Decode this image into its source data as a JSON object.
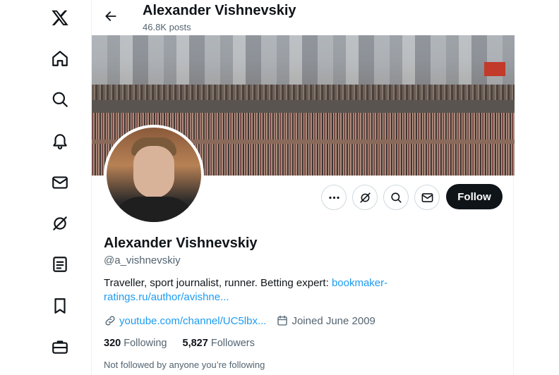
{
  "nav": {
    "items": [
      {
        "name": "x-logo",
        "icon": "x-logo-icon"
      },
      {
        "name": "home",
        "icon": "home-icon"
      },
      {
        "name": "explore",
        "icon": "search-icon"
      },
      {
        "name": "notifications",
        "icon": "bell-icon"
      },
      {
        "name": "messages",
        "icon": "envelope-icon"
      },
      {
        "name": "grok",
        "icon": "grok-icon"
      },
      {
        "name": "lists",
        "icon": "list-icon"
      },
      {
        "name": "bookmarks",
        "icon": "bookmark-icon"
      },
      {
        "name": "jobs",
        "icon": "briefcase-icon"
      }
    ]
  },
  "header": {
    "title": "Alexander Vishnevskiy",
    "post_count": "46.8K posts"
  },
  "profile": {
    "display_name": "Alexander Vishnevskiy",
    "handle": "@a_vishnevskiy",
    "bio_text": "Traveller, sport journalist, runner. Betting expert: ",
    "bio_link_line1": "bookmaker-",
    "bio_link_line2": "ratings.ru/author/avishne...",
    "website": "youtube.com/channel/UC5lbx...",
    "joined": "Joined June 2009",
    "following_count": "320",
    "following_label": "Following",
    "followers_count": "5,827",
    "followers_label": "Followers",
    "followed_by_note": "Not followed by anyone you’re following"
  },
  "actions": {
    "more_icon": "more-icon",
    "grok_icon": "grok-icon",
    "search_icon": "search-icon",
    "message_icon": "envelope-icon",
    "follow_label": "Follow"
  },
  "colors": {
    "accent": "#1d9bf0",
    "text": "#0f1419",
    "secondary": "#536471",
    "follow_bg": "#0f1419"
  }
}
